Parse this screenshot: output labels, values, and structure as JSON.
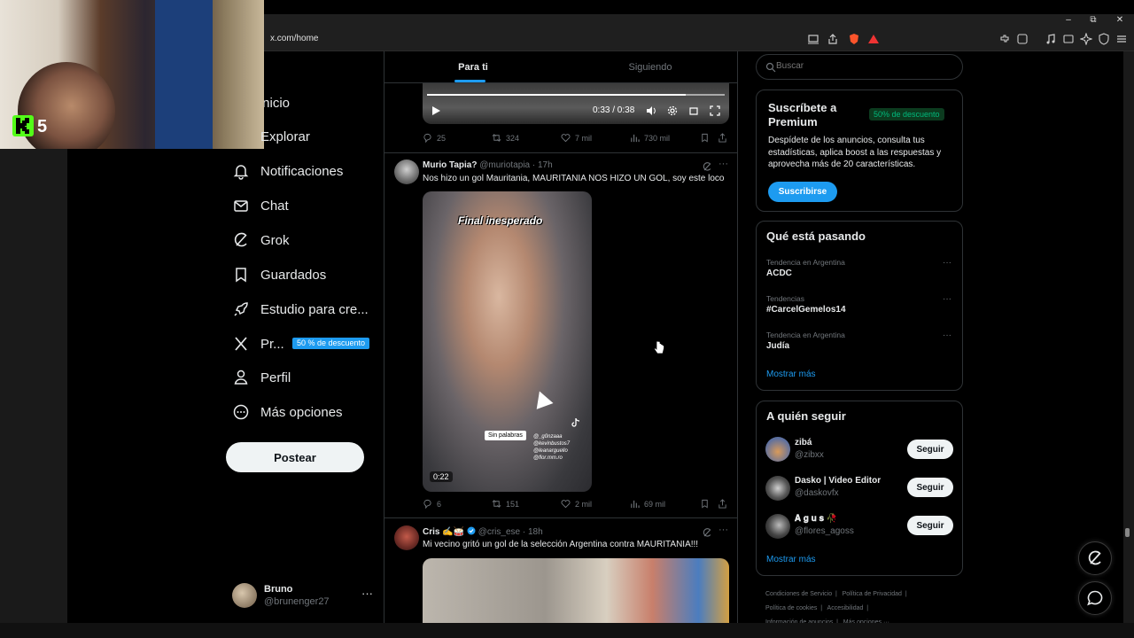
{
  "browser": {
    "url": "x.com/home",
    "window_controls": [
      "–",
      "⧉",
      "✕"
    ]
  },
  "webcam": {
    "overlay_number": "5"
  },
  "nav": {
    "items": [
      {
        "label": "Inicio",
        "icon": "home-icon"
      },
      {
        "label": "Explorar",
        "icon": "search-icon"
      },
      {
        "label": "Notificaciones",
        "icon": "bell-icon"
      },
      {
        "label": "Chat",
        "icon": "mail-icon"
      },
      {
        "label": "Grok",
        "icon": "grok-icon"
      },
      {
        "label": "Guardados",
        "icon": "bookmark-icon"
      },
      {
        "label": "Estudio para cre...",
        "icon": "rocket-icon"
      },
      {
        "label": "Pr...",
        "icon": "x-logo-icon"
      },
      {
        "label": "Perfil",
        "icon": "person-icon"
      },
      {
        "label": "Más opciones",
        "icon": "more-circle-icon"
      }
    ],
    "promo_badge": "50 % de descuento",
    "post_label": "Postear"
  },
  "account": {
    "name": "Bruno",
    "handle": "@brunenger27",
    "more": "···"
  },
  "feed": {
    "tabs": [
      {
        "label": "Para ti",
        "active": true
      },
      {
        "label": "Siguiendo",
        "active": false
      }
    ],
    "video1": {
      "time": "0:33 / 0:38",
      "progress": 0.87
    },
    "tweet1_actions": {
      "replies": "25",
      "reposts": "324",
      "likes": "7 mil",
      "views": "730 mil"
    },
    "tweet2": {
      "name": "Murio Tapia?",
      "handle": "@muriotapia",
      "time": "· 17h",
      "text": "Nos hizo un gol Mauritania, MAURITANIA NOS HIZO UN GOL, soy este loco",
      "video_overlay": "Final inesperado",
      "video_sticker": "Sin palabras",
      "video_handles": [
        "@_g0nzaaa",
        "@kevinbustos7",
        "@leanarguello",
        "@flor.mm.ro"
      ],
      "duration": "0:22",
      "actions": {
        "replies": "6",
        "reposts": "151",
        "likes": "2 mil",
        "views": "69 mil"
      }
    },
    "tweet3": {
      "name": "Cris ✍️🥁",
      "handle": "@cris_ese",
      "time": "· 18h",
      "text": "Mi vecino gritó un gol de la selección Argentina contra MAURITANIA!!!",
      "verified": true
    },
    "more": "···"
  },
  "sidebar": {
    "search_placeholder": "Buscar",
    "premium": {
      "title": "Suscríbete a Premium",
      "badge": "50% de descuento",
      "description": "Despídete de los anuncios, consulta tus estadísticas, aplica boost a las respuestas y aprovecha más de 20 características.",
      "button": "Suscribirse"
    },
    "trends": {
      "title": "Qué está pasando",
      "items": [
        {
          "meta": "Tendencia en Argentina",
          "name": "ACDC"
        },
        {
          "meta": "Tendencias",
          "name": "#CarcelGemelos14"
        },
        {
          "meta": "Tendencia en Argentina",
          "name": "Judía"
        }
      ],
      "show_more": "Mostrar más",
      "more": "···"
    },
    "follow": {
      "title": "A quién seguir",
      "items": [
        {
          "name": "zibá",
          "handle": "@zibxx",
          "button": "Seguir"
        },
        {
          "name": "Dasko | Video Editor",
          "handle": "@daskovfx",
          "button": "Seguir"
        },
        {
          "name": "𝐀 𝐠 𝐮 𝐬 🥀",
          "handle": "@flores_agoss",
          "button": "Seguir"
        }
      ],
      "show_more": "Mostrar más"
    },
    "footer": {
      "line1": "Condiciones de Servicio  |   Política de Privacidad  |",
      "line2": "Política de cookies  |   Accesibilidad  |",
      "line3": "Información de anuncios  |   Más opciones ···"
    }
  },
  "colors": {
    "accent": "#1d9bf0",
    "background": "#000000",
    "text": "#e7e9ea",
    "muted": "#71767b",
    "kick_green": "#53fc18"
  }
}
